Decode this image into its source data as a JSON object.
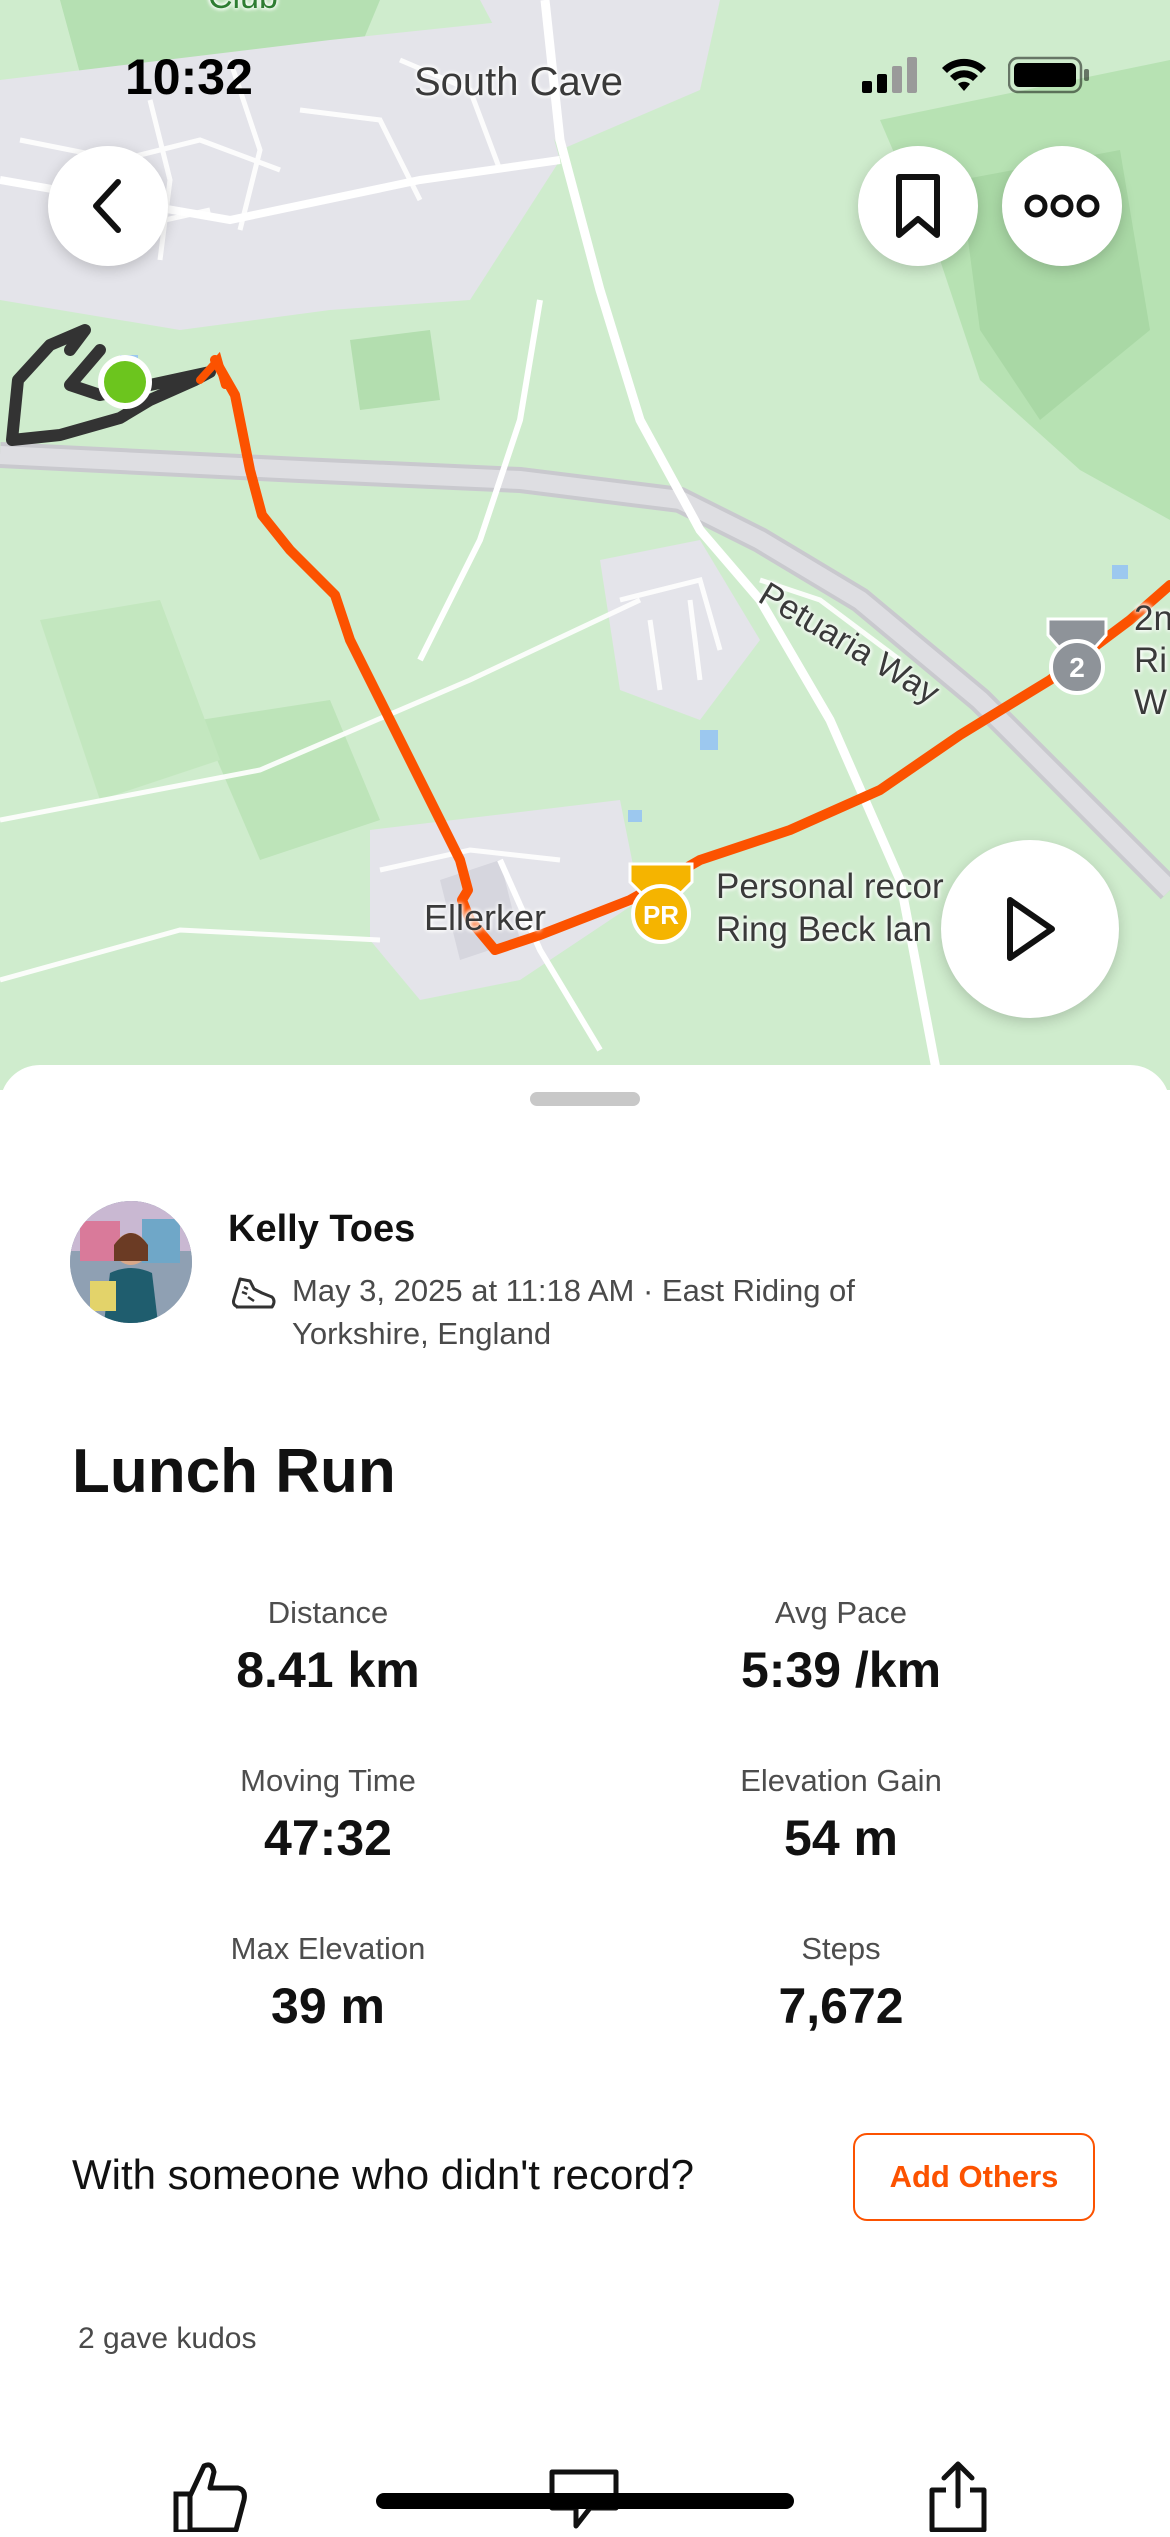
{
  "status_bar": {
    "time": "10:32"
  },
  "map": {
    "labels": {
      "club": "Club",
      "south_cave": "South Cave",
      "petuaria_way": "Petuaria Way",
      "ellerker": "Ellerker",
      "personal_record_line1": "Personal recor",
      "personal_record_line2": "Ring Beck lan",
      "segment_line1": "2n",
      "segment_line2": "Ri",
      "segment_line3": "W"
    },
    "pr_badge_text": "PR",
    "medal_rank": "2",
    "route_color": "#fc5200",
    "start_marker_color": "#6cc51e"
  },
  "header": {
    "back_icon": "chevron-left-icon",
    "save_icon": "bookmark-icon",
    "more_icon": "more-dots-icon"
  },
  "activity": {
    "athlete_name": "Kelly Toes",
    "sport_icon": "running-shoe-icon",
    "meta": "May 3, 2025 at 11:18 AM · East Riding of Yorkshire, England",
    "title": "Lunch Run"
  },
  "stats": [
    {
      "label": "Distance",
      "value": "8.41 km"
    },
    {
      "label": "Avg Pace",
      "value": "5:39 /km"
    },
    {
      "label": "Moving Time",
      "value": "47:32"
    },
    {
      "label": "Elevation Gain",
      "value": "54 m"
    },
    {
      "label": "Max Elevation",
      "value": "39 m"
    },
    {
      "label": "Steps",
      "value": "7,672"
    }
  ],
  "with_others": {
    "prompt": "With someone who didn't record?",
    "button_label": "Add Others",
    "accent": "#fc5200"
  },
  "kudos": {
    "text": "2 gave kudos"
  },
  "action_bar": {
    "kudos_icon": "thumbs-up-icon",
    "comment_icon": "comment-icon",
    "share_icon": "share-icon"
  }
}
